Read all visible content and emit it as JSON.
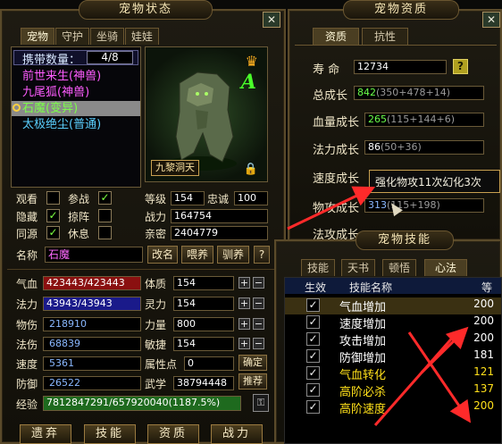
{
  "pet_status": {
    "title": "宠物状态",
    "close": "✕",
    "tabs": [
      "宠物",
      "守护",
      "坐骑",
      "娃娃"
    ],
    "carry_label": "携带数量：",
    "carry_value": "4/8",
    "pets": [
      {
        "name": "前世来生(神兽)",
        "color": "#ff5cff"
      },
      {
        "name": "九尾狐(神兽)",
        "color": "#ff5cff"
      },
      {
        "name": "石魔(变异)",
        "color": "#7cff4a"
      },
      {
        "name": "太极绝尘(普通)",
        "color": "#5ad0ff"
      }
    ],
    "selected_index": 2,
    "portrait_caption": "九黎洞天",
    "portrait_badge": "A",
    "checks": {
      "watch": {
        "label": "观看",
        "checked": false
      },
      "join": {
        "label": "参战",
        "checked": true
      },
      "hide": {
        "label": "隐藏",
        "checked": true
      },
      "formation": {
        "label": "掠阵",
        "checked": false
      },
      "same_source": {
        "label": "同源",
        "checked": true
      },
      "rest": {
        "label": "休息",
        "checked": false
      }
    },
    "level_label": "等级",
    "level": "154",
    "loyalty_label": "忠诚",
    "loyalty": "100",
    "power_label": "战力",
    "power": "164754",
    "intimacy_label": "亲密",
    "intimacy": "2404779",
    "name_label": "名称",
    "name_value": "石魔",
    "buttons": {
      "rename": "改名",
      "feed": "喂养",
      "tame": "驯养",
      "help": "?"
    },
    "stats": {
      "hp": {
        "label": "气血",
        "value": "423443/423443"
      },
      "mp": {
        "label": "法力",
        "value": "43943/43943"
      },
      "patk": {
        "label": "物伤",
        "value": "218910"
      },
      "matk": {
        "label": "法伤",
        "value": "68839"
      },
      "speed": {
        "label": "速度",
        "value": "5361"
      },
      "def": {
        "label": "防御",
        "value": "26522"
      },
      "exp": {
        "label": "经验",
        "value": "7812847291/657920040(1187.5%)"
      }
    },
    "attrs": {
      "con": {
        "label": "体质",
        "value": "154"
      },
      "spi": {
        "label": "灵力",
        "value": "154"
      },
      "str": {
        "label": "力量",
        "value": "800"
      },
      "agi": {
        "label": "敏捷",
        "value": "154"
      },
      "points": {
        "label": "属性点",
        "value": "0"
      },
      "martial": {
        "label": "武学",
        "value": "38794448"
      }
    },
    "confirm": "确定",
    "recommend": "推荐",
    "bottom_buttons": [
      "遗弃",
      "技能",
      "资质",
      "战力"
    ]
  },
  "pet_aptitude": {
    "title": "宠物资质",
    "tabs": [
      "资质",
      "抗性"
    ],
    "lifespan_label": "寿  命",
    "lifespan": "12734",
    "rows": [
      {
        "label": "总成长",
        "value": "842",
        "detail": "(350+478+14)"
      },
      {
        "label": "血量成长",
        "value": "265",
        "detail": "(115+144+6)"
      },
      {
        "label": "法力成长",
        "value": "86",
        "detail": "(50+36)"
      },
      {
        "label": "速度成长",
        "value": "",
        "detail": ""
      },
      {
        "label": "物攻成长",
        "value": "313",
        "detail": "(115+198)"
      },
      {
        "label": "法攻成长",
        "value": "",
        "detail": ""
      }
    ],
    "tooltip": "强化物攻11次幻化3次"
  },
  "pet_skills": {
    "title": "宠物技能",
    "tabs": [
      "技能",
      "天书",
      "顿悟",
      "心法"
    ],
    "headers": {
      "active": "生效",
      "name": "技能名称",
      "level": "等级"
    },
    "skills": [
      {
        "name": "气血增加",
        "level": "200",
        "color": "#ffffff",
        "checked": true
      },
      {
        "name": "速度增加",
        "level": "200",
        "color": "#ffffff",
        "checked": true
      },
      {
        "name": "攻击增加",
        "level": "200",
        "color": "#ffffff",
        "checked": true
      },
      {
        "name": "防御增加",
        "level": "181",
        "color": "#ffffff",
        "checked": true
      },
      {
        "name": "气血转化",
        "level": "121",
        "color": "#ffe01a",
        "checked": true
      },
      {
        "name": "高阶必杀",
        "level": "137",
        "color": "#ffe01a",
        "checked": true
      },
      {
        "name": "高阶速度",
        "level": "200",
        "color": "#ffe01a",
        "checked": true
      }
    ]
  },
  "colors": {
    "accent_red": "#ff2a2a",
    "gold": "#c8a050",
    "hp_bar": "#8a1010",
    "mp_bar": "#1a1a8a",
    "exp_bar": "#1e6a1e"
  }
}
